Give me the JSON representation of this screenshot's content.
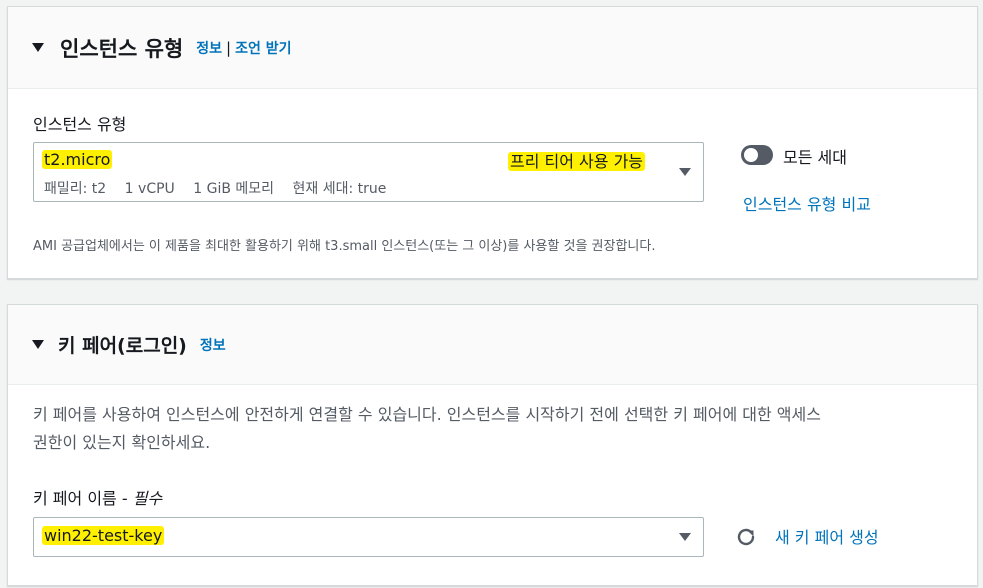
{
  "instance_type_panel": {
    "title": "인스턴스 유형",
    "info_link": "정보",
    "separator": "|",
    "advice_link": "조언 받기",
    "field_label": "인스턴스 유형",
    "selected_type": "t2.micro",
    "free_tier_badge": "프리 티어 사용 가능",
    "meta": {
      "family": "패밀리: t2",
      "vcpu": "1 vCPU",
      "memory": "1 GiB 메모리",
      "current_gen": "현재 세대: true"
    },
    "all_generations_label": "모든 세대",
    "all_generations_enabled": true,
    "compare_link": "인스턴스 유형 비교",
    "recommendation": "AMI 공급업체에서는 이 제품을 최대한 활용하기 위해 t3.small 인스턴스(또는 그 이상)를 사용할 것을 권장합니다."
  },
  "key_pair_panel": {
    "title": "키 페어(로그인)",
    "info_link": "정보",
    "description_line1": "키 페어를 사용하여 인스턴스에 안전하게 연결할 수 있습니다. 인스턴스를 시작하기 전에 선택한 키 페어에 대한 액세스",
    "description_line2": "권한이 있는지 확인하세요.",
    "field_label": "키 페어 이름 - ",
    "field_required": "필수",
    "selected_key": "win22-test-key",
    "create_link": "새 키 페어 생성"
  },
  "colors": {
    "link": "#0073bb",
    "highlight": "#fff000",
    "border": "#aab7b8"
  }
}
